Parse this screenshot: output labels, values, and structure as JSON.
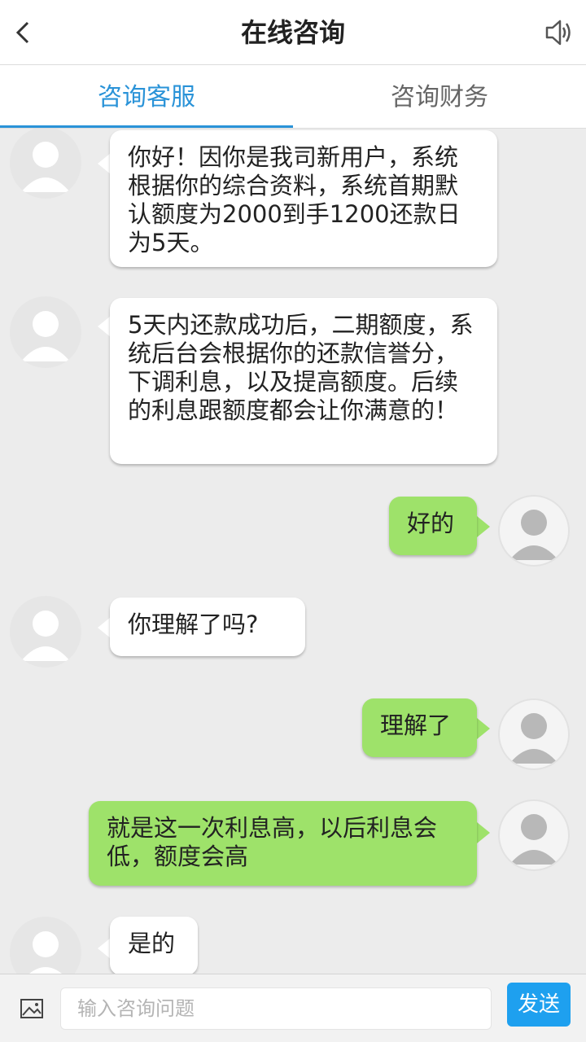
{
  "header": {
    "title": "在线咨询",
    "back_icon": "chevron-left-icon",
    "speaker_icon": "speaker-icon"
  },
  "tabs": [
    {
      "label": "咨询客服",
      "active": true
    },
    {
      "label": "咨询财务",
      "active": false
    }
  ],
  "colors": {
    "accent": "#2a93d8",
    "user_bubble": "#9ee26a",
    "agent_bubble": "#ffffff",
    "send_button": "#1ea0ef",
    "background": "#ececec"
  },
  "messages": [
    {
      "from": "agent",
      "text": "你好！因你是我司新用户，系统根据你的综合资料，系统首期默认额度为2000到手1200还款日为5天。"
    },
    {
      "from": "agent",
      "text": "5天内还款成功后，二期额度，系统后台会根据你的还款信誉分，下调利息，以及提高额度。后续的利息跟额度都会让你满意的！"
    },
    {
      "from": "user",
      "text": "好的"
    },
    {
      "from": "agent",
      "text": "你理解了吗?"
    },
    {
      "from": "user",
      "text": "理解了"
    },
    {
      "from": "user",
      "text": "就是这一次利息高，以后利息会低，额度会高"
    },
    {
      "from": "agent",
      "text": "是的"
    }
  ],
  "input": {
    "placeholder": "输入咨询问题",
    "value": "",
    "image_icon": "image-icon"
  },
  "send_label": "发送"
}
